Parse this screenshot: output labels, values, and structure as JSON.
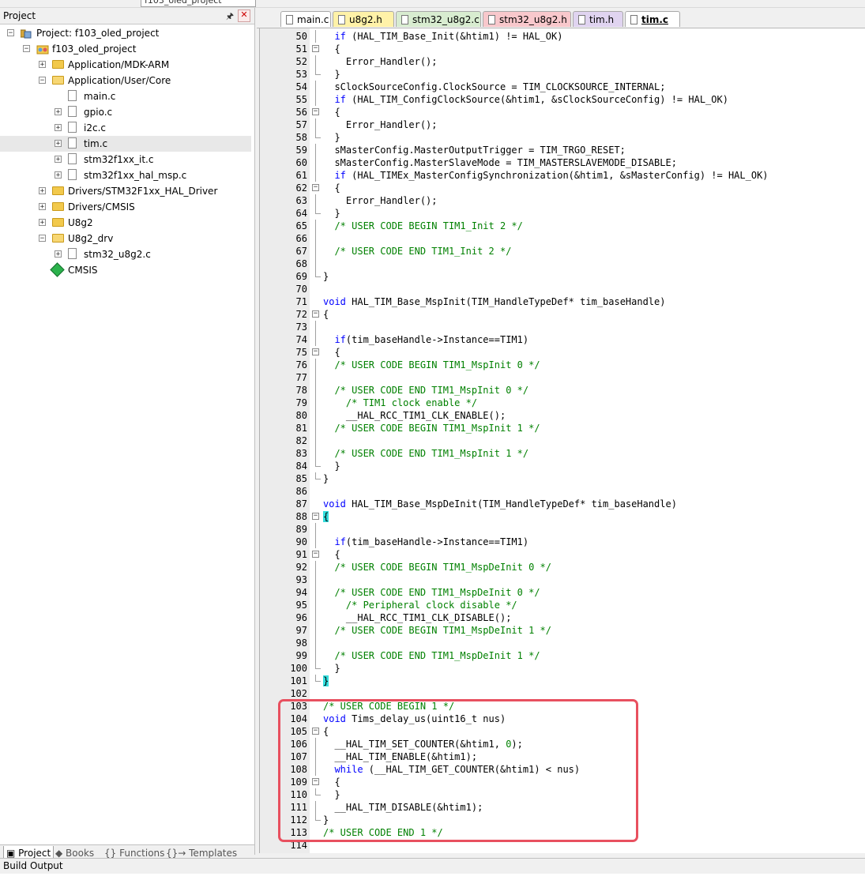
{
  "toolbar": {
    "target_combo": "f103_oled_project"
  },
  "project_panel": {
    "title": "Project",
    "tree": [
      {
        "label": "Project: f103_oled_project",
        "icon": "project-icon",
        "expanded": true
      },
      {
        "label": "f103_oled_project",
        "icon": "target-icon",
        "expanded": true
      },
      {
        "label": "Application/MDK-ARM",
        "icon": "folder-icon",
        "expanded": false
      },
      {
        "label": "Application/User/Core",
        "icon": "folder-open-icon",
        "expanded": true
      },
      {
        "label": "main.c",
        "icon": "file-icon"
      },
      {
        "label": "gpio.c",
        "icon": "file-icon"
      },
      {
        "label": "i2c.c",
        "icon": "file-icon"
      },
      {
        "label": "tim.c",
        "icon": "file-icon",
        "selected": true
      },
      {
        "label": "stm32f1xx_it.c",
        "icon": "file-icon"
      },
      {
        "label": "stm32f1xx_hal_msp.c",
        "icon": "file-icon"
      },
      {
        "label": "Drivers/STM32F1xx_HAL_Driver",
        "icon": "folder-icon",
        "expanded": false
      },
      {
        "label": "Drivers/CMSIS",
        "icon": "folder-icon",
        "expanded": false
      },
      {
        "label": "U8g2",
        "icon": "folder-icon",
        "expanded": false
      },
      {
        "label": "U8g2_drv",
        "icon": "folder-open-icon",
        "expanded": true
      },
      {
        "label": "stm32_u8g2.c",
        "icon": "file-icon"
      },
      {
        "label": "CMSIS",
        "icon": "cmsis-icon"
      }
    ],
    "tabs": [
      "Project",
      "Books",
      "Functions",
      "Templates"
    ]
  },
  "file_tabs": [
    {
      "label": "main.c",
      "color": "#ffffff",
      "active": false
    },
    {
      "label": "u8g2.h",
      "color": "#fff2a8",
      "active": false
    },
    {
      "label": "stm32_u8g2.c",
      "color": "#d8ecd0",
      "active": false
    },
    {
      "label": "stm32_u8g2.h",
      "color": "#f8c8cc",
      "active": false
    },
    {
      "label": "tim.h",
      "color": "#e0d4f0",
      "active": false
    },
    {
      "label": "tim.c",
      "color": "#d8ecd0",
      "active": true
    }
  ],
  "code_lines": [
    {
      "n": "50",
      "f": "line",
      "t": "  <span class=\"kw\">if</span> (HAL_TIM_Base_Init(&amp;htim1) != HAL_OK)"
    },
    {
      "n": "51",
      "f": "minus",
      "t": "  {"
    },
    {
      "n": "52",
      "f": "line",
      "t": "    Error_Handler();"
    },
    {
      "n": "53",
      "f": "end",
      "t": "  }"
    },
    {
      "n": "54",
      "f": "line",
      "t": "  sClockSourceConfig.ClockSource = TIM_CLOCKSOURCE_INTERNAL;"
    },
    {
      "n": "55",
      "f": "line",
      "t": "  <span class=\"kw\">if</span> (HAL_TIM_ConfigClockSource(&amp;htim1, &amp;sClockSourceConfig) != HAL_OK)"
    },
    {
      "n": "56",
      "f": "minus",
      "t": "  {"
    },
    {
      "n": "57",
      "f": "line",
      "t": "    Error_Handler();"
    },
    {
      "n": "58",
      "f": "end",
      "t": "  }"
    },
    {
      "n": "59",
      "f": "line",
      "t": "  sMasterConfig.MasterOutputTrigger = TIM_TRGO_RESET;"
    },
    {
      "n": "60",
      "f": "line",
      "t": "  sMasterConfig.MasterSlaveMode = TIM_MASTERSLAVEMODE_DISABLE;"
    },
    {
      "n": "61",
      "f": "line",
      "t": "  <span class=\"kw\">if</span> (HAL_TIMEx_MasterConfigSynchronization(&amp;htim1, &amp;sMasterConfig) != HAL_OK)"
    },
    {
      "n": "62",
      "f": "minus",
      "t": "  {"
    },
    {
      "n": "63",
      "f": "line",
      "t": "    Error_Handler();"
    },
    {
      "n": "64",
      "f": "end",
      "t": "  }"
    },
    {
      "n": "65",
      "f": "line",
      "t": "  <span class=\"cm\">/* USER CODE BEGIN TIM1_Init 2 */</span>"
    },
    {
      "n": "66",
      "f": "line",
      "t": ""
    },
    {
      "n": "67",
      "f": "line",
      "t": "  <span class=\"cm\">/* USER CODE END TIM1_Init 2 */</span>"
    },
    {
      "n": "68",
      "f": "line",
      "t": ""
    },
    {
      "n": "69",
      "f": "end",
      "t": "}"
    },
    {
      "n": "70",
      "f": "",
      "t": ""
    },
    {
      "n": "71",
      "f": "",
      "t": "<span class=\"kw\">void</span> HAL_TIM_Base_MspInit(TIM_HandleTypeDef* tim_baseHandle)"
    },
    {
      "n": "72",
      "f": "minus",
      "t": "{"
    },
    {
      "n": "73",
      "f": "line",
      "t": ""
    },
    {
      "n": "74",
      "f": "line",
      "t": "  <span class=\"kw\">if</span>(tim_baseHandle-&gt;Instance==TIM1)"
    },
    {
      "n": "75",
      "f": "minus",
      "t": "  {"
    },
    {
      "n": "76",
      "f": "line",
      "t": "  <span class=\"cm\">/* USER CODE BEGIN TIM1_MspInit 0 */</span>"
    },
    {
      "n": "77",
      "f": "line",
      "t": ""
    },
    {
      "n": "78",
      "f": "line",
      "t": "  <span class=\"cm\">/* USER CODE END TIM1_MspInit 0 */</span>"
    },
    {
      "n": "79",
      "f": "line",
      "t": "    <span class=\"cm\">/* TIM1 clock enable */</span>"
    },
    {
      "n": "80",
      "f": "line",
      "t": "    __HAL_RCC_TIM1_CLK_ENABLE();"
    },
    {
      "n": "81",
      "f": "line",
      "t": "  <span class=\"cm\">/* USER CODE BEGIN TIM1_MspInit 1 */</span>"
    },
    {
      "n": "82",
      "f": "line",
      "t": ""
    },
    {
      "n": "83",
      "f": "line",
      "t": "  <span class=\"cm\">/* USER CODE END TIM1_MspInit 1 */</span>"
    },
    {
      "n": "84",
      "f": "end",
      "t": "  }"
    },
    {
      "n": "85",
      "f": "end",
      "t": "}"
    },
    {
      "n": "86",
      "f": "",
      "t": ""
    },
    {
      "n": "87",
      "f": "",
      "t": "<span class=\"kw\">void</span> HAL_TIM_Base_MspDeInit(TIM_HandleTypeDef* tim_baseHandle)"
    },
    {
      "n": "88",
      "f": "minus",
      "t": "<span class=\"brace-hl\">{</span>"
    },
    {
      "n": "89",
      "f": "line",
      "t": ""
    },
    {
      "n": "90",
      "f": "line",
      "t": "  <span class=\"kw\">if</span>(tim_baseHandle-&gt;Instance==TIM1)"
    },
    {
      "n": "91",
      "f": "minus",
      "t": "  {"
    },
    {
      "n": "92",
      "f": "line",
      "t": "  <span class=\"cm\">/* USER CODE BEGIN TIM1_MspDeInit 0 */</span>"
    },
    {
      "n": "93",
      "f": "line",
      "t": ""
    },
    {
      "n": "94",
      "f": "line",
      "t": "  <span class=\"cm\">/* USER CODE END TIM1_MspDeInit 0 */</span>"
    },
    {
      "n": "95",
      "f": "line",
      "t": "    <span class=\"cm\">/* Peripheral clock disable */</span>"
    },
    {
      "n": "96",
      "f": "line",
      "t": "    __HAL_RCC_TIM1_CLK_DISABLE();"
    },
    {
      "n": "97",
      "f": "line",
      "t": "  <span class=\"cm\">/* USER CODE BEGIN TIM1_MspDeInit 1 */</span>"
    },
    {
      "n": "98",
      "f": "line",
      "t": ""
    },
    {
      "n": "99",
      "f": "line",
      "t": "  <span class=\"cm\">/* USER CODE END TIM1_MspDeInit 1 */</span>"
    },
    {
      "n": "100",
      "f": "end",
      "t": "  }"
    },
    {
      "n": "101",
      "f": "end",
      "t": "<span class=\"brace-hl\">}</span>"
    },
    {
      "n": "102",
      "f": "",
      "t": ""
    },
    {
      "n": "103",
      "f": "",
      "t": "<span class=\"cm\">/* USER CODE BEGIN 1 */</span>"
    },
    {
      "n": "104",
      "f": "",
      "t": "<span class=\"kw\">void</span> Tims_delay_us(uint16_t nus)"
    },
    {
      "n": "105",
      "f": "minus",
      "t": "{"
    },
    {
      "n": "106",
      "f": "line",
      "t": "  __HAL_TIM_SET_COUNTER(&amp;htim1, <span class=\"num\">0</span>);"
    },
    {
      "n": "107",
      "f": "line",
      "t": "  __HAL_TIM_ENABLE(&amp;htim1);"
    },
    {
      "n": "108",
      "f": "line",
      "t": "  <span class=\"kw\">while</span> (__HAL_TIM_GET_COUNTER(&amp;htim1) &lt; nus)"
    },
    {
      "n": "109",
      "f": "minus",
      "t": "  {"
    },
    {
      "n": "110",
      "f": "end",
      "t": "  }"
    },
    {
      "n": "111",
      "f": "line",
      "t": "  __HAL_TIM_DISABLE(&amp;htim1);"
    },
    {
      "n": "112",
      "f": "end",
      "t": "}"
    },
    {
      "n": "113",
      "f": "",
      "t": "<span class=\"cm\">/* USER CODE END 1 */</span>"
    },
    {
      "n": "114",
      "f": "",
      "t": ""
    }
  ],
  "build_output": {
    "title": "Build Output"
  }
}
